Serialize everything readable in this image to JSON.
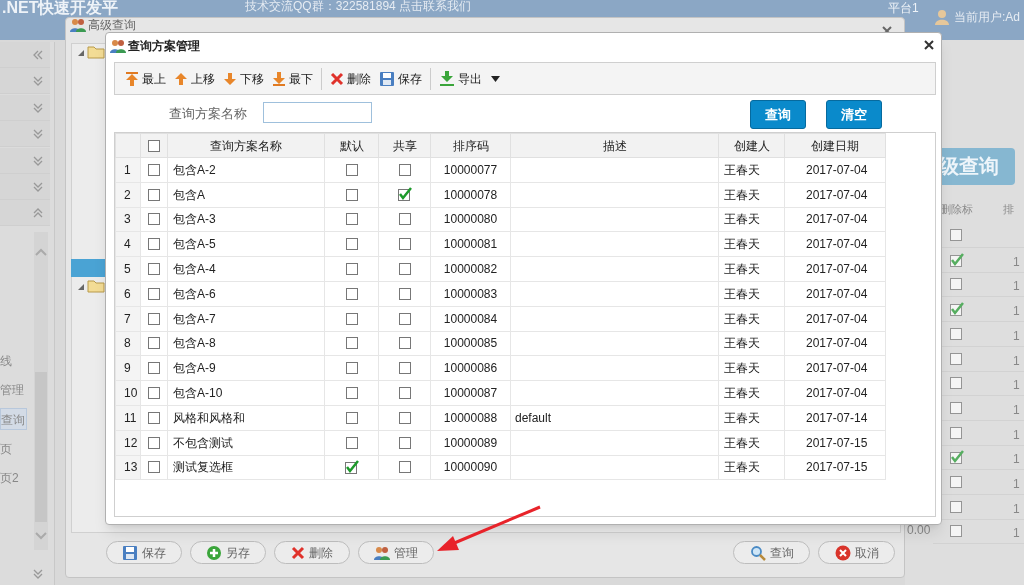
{
  "header": {
    "title": ".NET快速开发平",
    "qq": "技术交流QQ群：322581894 点击联系我们",
    "platform": "平台1",
    "user": "当前用户:Ad"
  },
  "sidebar": {
    "items": [
      {
        "label": "线",
        "selected": false
      },
      {
        "label": "管理",
        "selected": false
      },
      {
        "label": "查询",
        "selected": true
      },
      {
        "label": "页",
        "selected": false
      },
      {
        "label": "页2",
        "selected": false
      }
    ]
  },
  "background_grid": {
    "button": "级查询",
    "columns": [
      "删除标",
      "排"
    ],
    "footer_value": "0.00",
    "rows": [
      {
        "checked": false
      },
      {
        "checked": true,
        "value": "1"
      },
      {
        "checked": false,
        "value": "1"
      },
      {
        "checked": true,
        "value": "1"
      },
      {
        "checked": false,
        "value": "1"
      },
      {
        "checked": false,
        "value": "1"
      },
      {
        "checked": false,
        "value": "1"
      },
      {
        "checked": false,
        "value": "1"
      },
      {
        "checked": false,
        "value": "1"
      },
      {
        "checked": true,
        "value": "1"
      },
      {
        "checked": false,
        "value": "1"
      },
      {
        "checked": false,
        "value": "1"
      },
      {
        "checked": false,
        "value": "1"
      }
    ]
  },
  "back_window": {
    "title": "高级查询",
    "buttons": [
      {
        "label": "保存",
        "kind": "save"
      },
      {
        "label": "另存",
        "kind": "plus"
      },
      {
        "label": "删除",
        "kind": "cross"
      },
      {
        "label": "管理",
        "kind": "users"
      }
    ],
    "right_buttons": [
      {
        "label": "查询",
        "kind": "search"
      },
      {
        "label": "取消",
        "kind": "cancel"
      }
    ]
  },
  "dialog": {
    "title": "查询方案管理",
    "toolbar": [
      {
        "label": "最上",
        "kind": "top"
      },
      {
        "label": "上移",
        "kind": "up"
      },
      {
        "label": "下移",
        "kind": "down"
      },
      {
        "label": "最下",
        "kind": "bottom"
      },
      {
        "label": "删除",
        "kind": "cross"
      },
      {
        "label": "保存",
        "kind": "save"
      },
      {
        "label": "导出",
        "kind": "export"
      }
    ],
    "all_checked": false,
    "search_label": "查询方案名称",
    "buttons": [
      "查询",
      "清空"
    ],
    "columns": [
      "查询方案名称",
      "默认",
      "共享",
      "排序码",
      "描述",
      "创建人",
      "创建日期"
    ],
    "rows": [
      {
        "index": "1",
        "checked": false,
        "name": "包含A-2",
        "default": false,
        "shared": false,
        "code": "10000077",
        "creator": "王春天",
        "date": "2017-07-04"
      },
      {
        "index": "2",
        "checked": false,
        "name": "包含A",
        "default": false,
        "shared": true,
        "code": "10000078",
        "creator": "王春天",
        "date": "2017-07-04"
      },
      {
        "index": "3",
        "checked": false,
        "name": "包含A-3",
        "default": false,
        "shared": false,
        "code": "10000080",
        "creator": "王春天",
        "date": "2017-07-04"
      },
      {
        "index": "4",
        "checked": false,
        "name": "包含A-5",
        "default": false,
        "shared": false,
        "code": "10000081",
        "creator": "王春天",
        "date": "2017-07-04"
      },
      {
        "index": "5",
        "checked": false,
        "name": "包含A-4",
        "default": false,
        "shared": false,
        "code": "10000082",
        "creator": "王春天",
        "date": "2017-07-04"
      },
      {
        "index": "6",
        "checked": false,
        "name": "包含A-6",
        "default": false,
        "shared": false,
        "code": "10000083",
        "creator": "王春天",
        "date": "2017-07-04"
      },
      {
        "index": "7",
        "checked": false,
        "name": "包含A-7",
        "default": false,
        "shared": false,
        "code": "10000084",
        "creator": "王春天",
        "date": "2017-07-04"
      },
      {
        "index": "8",
        "checked": false,
        "name": "包含A-8",
        "default": false,
        "shared": false,
        "code": "10000085",
        "creator": "王春天",
        "date": "2017-07-04"
      },
      {
        "index": "9",
        "checked": false,
        "name": "包含A-9",
        "default": false,
        "shared": false,
        "code": "10000086",
        "creator": "王春天",
        "date": "2017-07-04"
      },
      {
        "index": "10",
        "checked": false,
        "name": "包含A-10",
        "default": false,
        "shared": false,
        "code": "10000087",
        "creator": "王春天",
        "date": "2017-07-04"
      },
      {
        "index": "11",
        "checked": false,
        "name": "风格和风格和",
        "default": false,
        "shared": false,
        "code": "10000088",
        "description": "default",
        "creator": "王春天",
        "date": "2017-07-14"
      },
      {
        "index": "12",
        "checked": false,
        "name": "不包含测试",
        "default": false,
        "shared": false,
        "code": "10000089",
        "creator": "王春天",
        "date": "2017-07-15"
      },
      {
        "index": "13",
        "checked": false,
        "name": "测试复选框",
        "default": true,
        "shared": false,
        "code": "10000090",
        "creator": "王春天",
        "date": "2017-07-15"
      }
    ]
  }
}
